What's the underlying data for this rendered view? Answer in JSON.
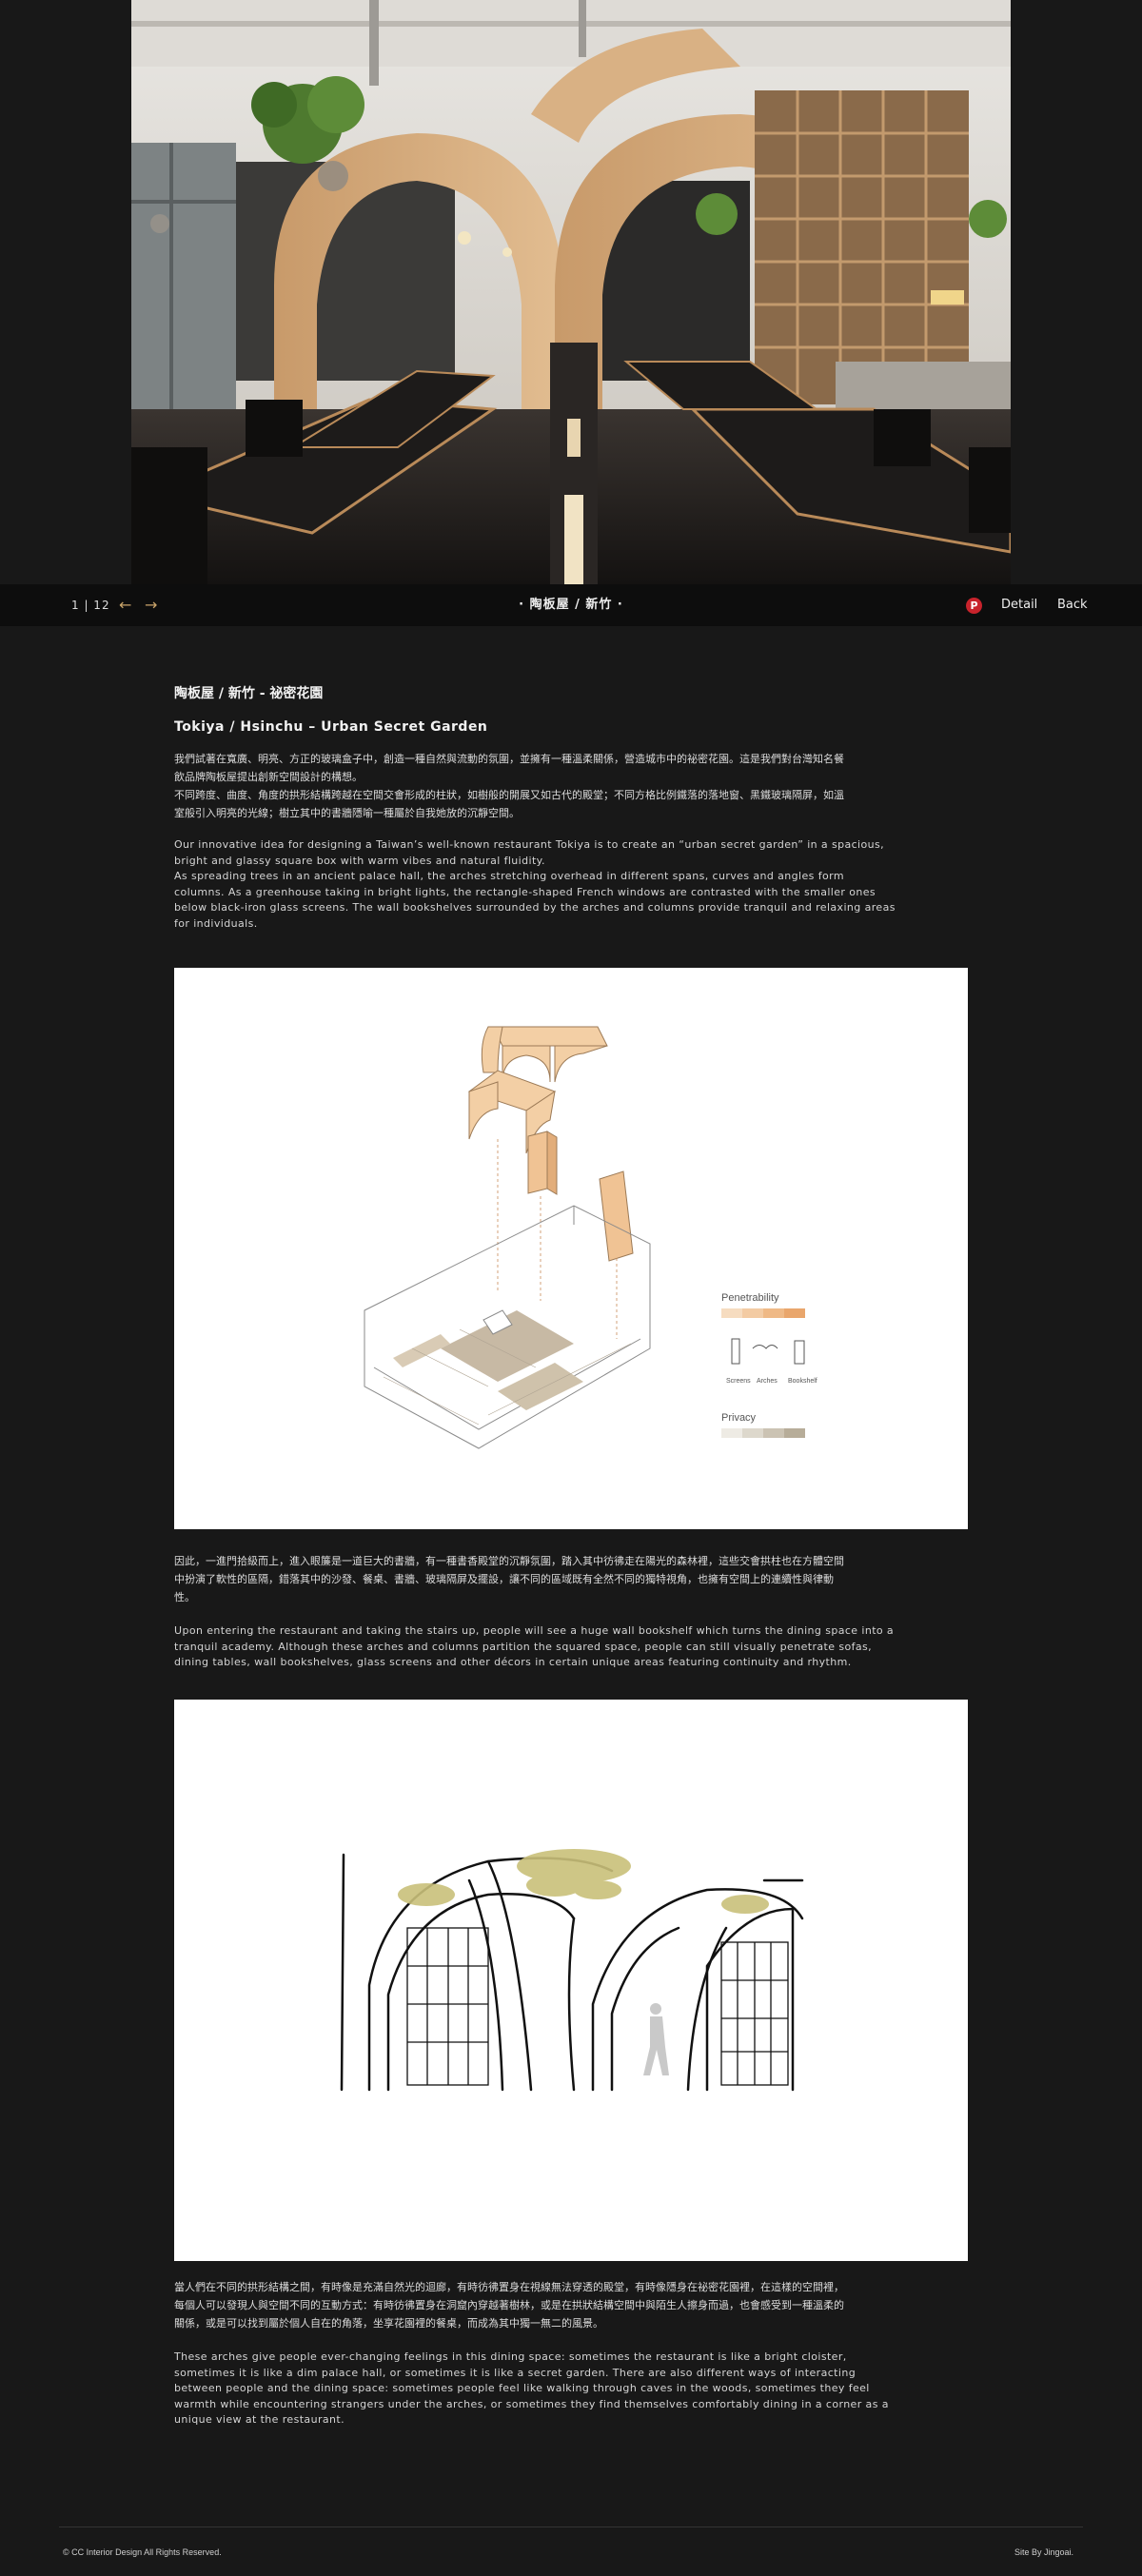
{
  "nav": {
    "pager": "1 | 12",
    "prev_icon": "arrow-left-icon",
    "next_icon": "arrow-right-icon",
    "title": "· 陶板屋 / 新竹 ·",
    "pinterest_icon": "pinterest-icon",
    "pinterest_glyph": "P",
    "detail": "Detail",
    "back": "Back"
  },
  "article": {
    "title_zh": "陶板屋 / 新竹 - 祕密花園",
    "title_en": "Tokiya / Hsinchu – Urban Secret Garden",
    "p1_zh": "我們試著在寬廣、明亮、方正的玻璃盒子中，創造一種自然與流動的氛圍，並擁有一種溫柔關係，營造城市中的祕密花園。這是我們對台灣知名餐\n飲品牌陶板屋提出創新空間設計的構想。\n不同跨度、曲度、角度的拱形結構跨越在空間交會形成的柱狀，如樹般的開展又如古代的殿堂；不同方格比例鐵落的落地窗、黑鐵玻璃隔屏，如溫\n室般引入明亮的光線；樹立其中的書牆隱喻一種屬於自我她放的沉靜空間。",
    "p1_en": "Our innovative idea for designing a Taiwan’s well-known restaurant Tokiya is to create an “urban secret garden” in a spacious,\nbright and glassy square box with warm vibes and natural fluidity.\nAs spreading trees in an ancient palace hall, the arches stretching overhead in different spans, curves and angles form\ncolumns. As a greenhouse taking in bright lights, the rectangle-shaped French windows are contrasted with the smaller ones\nbelow black-iron glass screens. The wall bookshelves surrounded by the arches and columns provide tranquil and relaxing areas\nfor individuals.",
    "p2_zh": "因此，一進門拾級而上，進入眼簾是一道巨大的書牆，有一種書香殿堂的沉靜氛圍，踏入其中彷彿走在陽光的森林裡，這些交會拱柱也在方體空間\n中扮演了軟性的區隔，錯落其中的沙發、餐桌、書牆、玻璃隔屏及擺設，讓不同的區域既有全然不同的獨特視角，也擁有空間上的連續性與律動\n性。",
    "p2_en": "Upon entering the restaurant and taking the stairs up, people will see a huge wall bookshelf which turns the dining space into a\ntranquil academy. Although these arches and columns partition the squared space, people can still visually penetrate sofas,\ndining tables, wall bookshelves, glass screens and other décors in certain unique areas featuring continuity and rhythm.",
    "p3_zh": "當人們在不同的拱形結構之間，有時像是充滿自然光的迴廊，有時彷彿置身在視線無法穿透的殿堂，有時像隱身在祕密花園裡，在這樣的空間裡，\n每個人可以發現人與空間不同的互動方式：有時彷彿置身在洞窟內穿越著樹林，或是在拱狀結構空間中與陌生人擦身而過，也會感受到一種溫柔的\n關係，或是可以找到屬於個人自在的角落，坐享花園裡的餐桌，而成為其中獨一無二的風景。",
    "p3_en": "These arches give people ever-changing feelings in this dining space: sometimes the restaurant is like a bright cloister,\nsometimes it is like a dim palace hall, or sometimes it is like a secret garden. There are also different ways of interacting\nbetween people and the dining space: sometimes people feel like walking through caves in the woods, sometimes they feel\nwarmth while encountering strangers under the arches, or sometimes they find themselves comfortably dining in a corner as a\nunique view at the restaurant."
  },
  "diagram1": {
    "legend_penetrability": "Penetrability",
    "legend_items": [
      "Screens",
      "Arches",
      "Bookshelf"
    ],
    "legend_privacy": "Privacy"
  },
  "footer": {
    "copyright": "© CC Interior Design All Rights Reserved.",
    "credit": "Site By Jingoai."
  },
  "colors": {
    "accent": "#c9a46a",
    "wood": "#e8c39a",
    "background": "#181818"
  }
}
